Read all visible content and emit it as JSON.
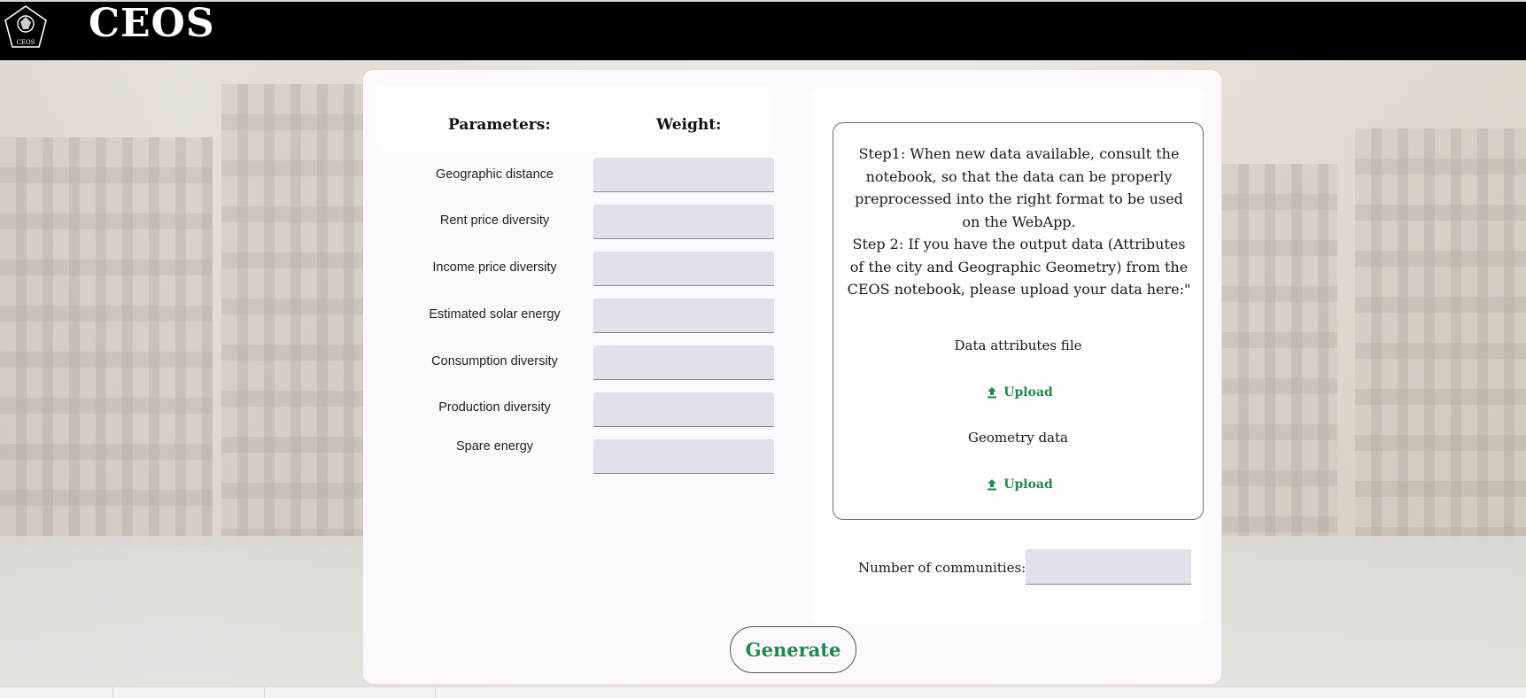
{
  "header": {
    "brand": "CEOS",
    "logo_text": "CEOS"
  },
  "parameters": {
    "header_parameters": "Parameters:",
    "header_weight": "Weight:",
    "items": [
      {
        "label": "Geographic distance"
      },
      {
        "label": "Rent price diversity"
      },
      {
        "label": "Income price diversity"
      },
      {
        "label": "Estimated solar energy"
      },
      {
        "label": "Consumption diversity"
      },
      {
        "label": "Production diversity"
      },
      {
        "label": "Spare energy"
      }
    ]
  },
  "info": {
    "step_text": "Step1: When new data available, consult the notebook, so that the data can be properly preprocessed into the right format to be used on the WebApp.\nStep 2: If you have the output data (Attributes of the city and Geographic Geometry) from the CEOS notebook, please upload your data here:\"",
    "attributes_label": "Data  attributes file",
    "geometry_label": "Geometry data",
    "upload_label": "Upload"
  },
  "communities": {
    "label": "Number of communities:"
  },
  "actions": {
    "generate_label": "Generate"
  },
  "colors": {
    "header_bg": "#000000",
    "accent_green": "#1f8a4c",
    "input_bg": "#e4dfe9",
    "card_bg": "#fdf8fc"
  }
}
